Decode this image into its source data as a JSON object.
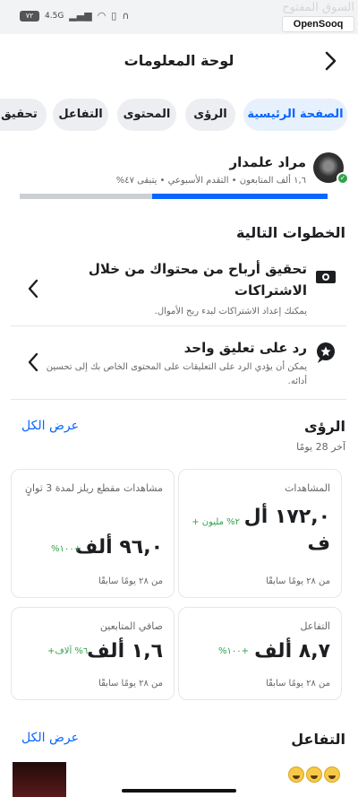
{
  "status_bar": {
    "battery": "٧٢",
    "network": "4.5G",
    "watermark_ar": "السوق المفتوح",
    "watermark_en": "OpenSooq"
  },
  "header": {
    "title": "لوحة المعلومات"
  },
  "tabs": [
    {
      "label": "الصفحة الرئيسية",
      "active": true
    },
    {
      "label": "الرؤى"
    },
    {
      "label": "المحتوى"
    },
    {
      "label": "التفاعل"
    },
    {
      "label": "تحقيق أ"
    }
  ],
  "profile": {
    "name": "مراد علمدار",
    "meta": "١,٦ ألف المتابعون • التقدم الأسبوعي • يتبقى ٤٧%",
    "progress_fraction": 0.57
  },
  "next_steps": {
    "title": "الخطوات التالية",
    "items": [
      {
        "icon": "monetization-icon",
        "title": "تحقيق أرباح من محتواك من خلال الاشتراكات",
        "desc": "يمكنك إعداد الاشتراكات لبدء ربح الأموال."
      },
      {
        "icon": "comment-star-icon",
        "title": "رد على تعليق واحد",
        "desc": "يمكن أن يؤدي الرد على التعليقات على المحتوى الخاص بك إلى تحسين أدائه."
      }
    ]
  },
  "insights": {
    "title": "الرؤى",
    "subtitle": "آخر 28 يومًا",
    "see_all": "عرض الكل",
    "cards": [
      {
        "label": "المشاهدات",
        "value": "١٧٢,٠ أل ف",
        "delta": "٢% مليون +",
        "foot": "من ٢٨ يومًا سابقًا"
      },
      {
        "label": "مشاهدات مقطع ريلز لمدة 3 ثوانٍ",
        "value": "٩٦,٠ ألف",
        "delta": "+١٠٠%",
        "foot": "من ٢٨ يومًا سابقًا"
      },
      {
        "label": "التفاعل",
        "value": "٨,٧ ألف",
        "delta": "+١٠٠%",
        "foot": "من ٢٨ يومًا سابقًا"
      },
      {
        "label": "صافي المتابعين",
        "value": "١,٦ ألف",
        "delta": "٦% آلاف+",
        "foot": "من ٢٨ يومًا سابقًا"
      }
    ]
  },
  "engagement": {
    "title": "التفاعل",
    "see_all": "عرض الكل"
  },
  "colors": {
    "accent": "#0866ff",
    "positive": "#31a24c",
    "muted": "#65676b"
  }
}
